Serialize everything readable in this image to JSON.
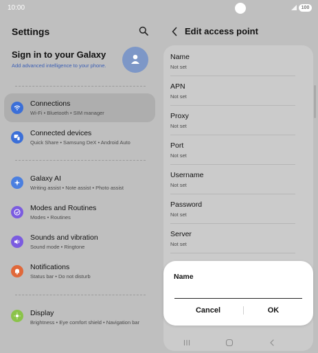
{
  "status_bar": {
    "time": "10:00",
    "battery": "100"
  },
  "left": {
    "title": "Settings",
    "galaxy": {
      "title": "Sign in to your Galaxy",
      "subtitle": "Add advanced intelligence to your phone."
    },
    "items": [
      {
        "label": "Connections",
        "sub": "Wi-Fi • Bluetooth • SIM manager",
        "icon": "wifi-icon",
        "color": "#3b6fd8",
        "selected": true
      },
      {
        "label": "Connected devices",
        "sub": "Quick Share • Samsung DeX • Android Auto",
        "icon": "devices-icon",
        "color": "#3b6fd8"
      },
      {
        "label": "Galaxy AI",
        "sub": "Writing assist • Note assist • Photo assist",
        "icon": "ai-sparkle-icon",
        "color": "#4a7fe0"
      },
      {
        "label": "Modes and Routines",
        "sub": "Modes • Routines",
        "icon": "check-circle-icon",
        "color": "#7b5be0"
      },
      {
        "label": "Sounds and vibration",
        "sub": "Sound mode • Ringtone",
        "icon": "speaker-icon",
        "color": "#7b5be0"
      },
      {
        "label": "Notifications",
        "sub": "Status bar • Do not disturb",
        "icon": "bell-icon",
        "color": "#e0683a"
      },
      {
        "label": "Display",
        "sub": "Brightness • Eye comfort shield • Navigation bar",
        "icon": "sun-icon",
        "color": "#8bc34a"
      }
    ]
  },
  "right": {
    "title": "Edit access point",
    "rows": [
      {
        "label": "Name",
        "value": "Not set"
      },
      {
        "label": "APN",
        "value": "Not set"
      },
      {
        "label": "Proxy",
        "value": "Not set"
      },
      {
        "label": "Port",
        "value": "Not set"
      },
      {
        "label": "Username",
        "value": "Not set"
      },
      {
        "label": "Password",
        "value": "Not set"
      },
      {
        "label": "Server",
        "value": "Not set"
      }
    ]
  },
  "dialog": {
    "title": "Name",
    "input_value": "",
    "cancel_label": "Cancel",
    "ok_label": "OK"
  }
}
